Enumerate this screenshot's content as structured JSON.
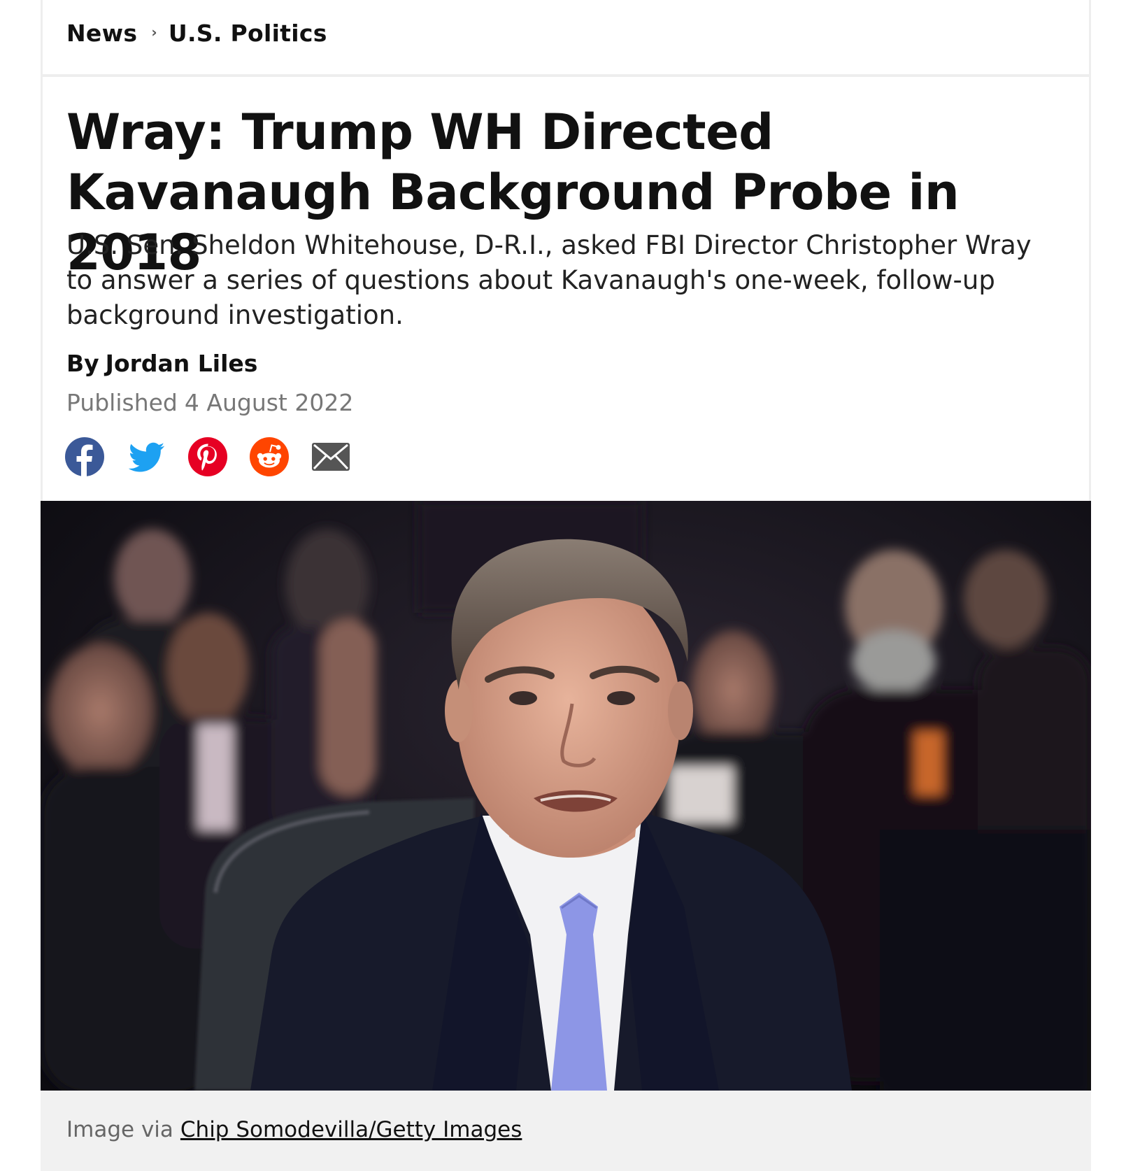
{
  "breadcrumb": {
    "items": [
      "News",
      "U.S. Politics"
    ],
    "separator": "›"
  },
  "article": {
    "headline": "Wray: Trump WH Directed Kavanaugh Background Probe in 2018",
    "dek": "U.S. Sen. Sheldon Whitehouse, D-R.I., asked FBI Director Christopher Wray to answer a series of questions about Kavanaugh's one-week, follow-up background investigation.",
    "byline_prefix": "By",
    "author": "Jordan Liles",
    "published_label": "Published",
    "published_date": "4 August 2022"
  },
  "share": {
    "icons": [
      "facebook-icon",
      "twitter-icon",
      "pinterest-icon",
      "reddit-icon",
      "email-icon"
    ],
    "colors": {
      "facebook": "#3b5998",
      "twitter": "#1da1f2",
      "pinterest": "#e60023",
      "reddit": "#ff4500",
      "email": "#555555"
    }
  },
  "hero_image": {
    "caption_prefix": "Image via",
    "credit": "Chip Somodevilla/Getty Images"
  }
}
